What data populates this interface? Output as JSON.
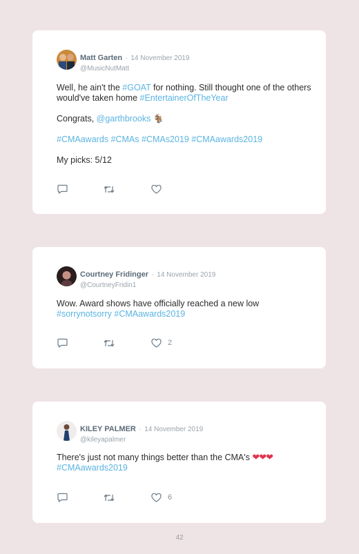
{
  "tweets": [
    {
      "name": "Matt Garten",
      "separator": "·",
      "date": "14 November 2019",
      "handle": "@MusicNutMatt",
      "line1_a": "Well, he ain't the ",
      "line1_link": "#GOAT",
      "line1_b": " for nothing. Still thought one of the others would've taken home ",
      "line1_link2": "#EntertainerOfTheYear",
      "line2_a": "Congrats, ",
      "line2_link": "@garthbrooks",
      "line2_emoji": "🐐",
      "tags": [
        "#CMAawards",
        "#CMAs",
        "#CMAs2019",
        "#CMAawards2019"
      ],
      "line4": "My picks: 5/12",
      "likes": ""
    },
    {
      "name": "Courtney Fridinger",
      "separator": "·",
      "date": "14 November 2019",
      "handle": "@CourtneyFridin1",
      "text": "Wow. Award shows have officially reached a new low",
      "tags": [
        "#sorrynotsorry",
        "#CMAawards2019"
      ],
      "likes": "2"
    },
    {
      "name": "KILEY PALMER",
      "separator": "·",
      "date": "14 November 2019",
      "handle": "@kileyapalmer",
      "text": "There's just not many things better than the CMA's ",
      "emoji": "❤❤❤",
      "tags": [
        "#CMAawards2019"
      ],
      "likes": "6"
    }
  ],
  "page_number": "42",
  "colors": {
    "link": "#5ab4e2",
    "background": "#efe4e5",
    "heart_emoji": "#e0344f"
  }
}
